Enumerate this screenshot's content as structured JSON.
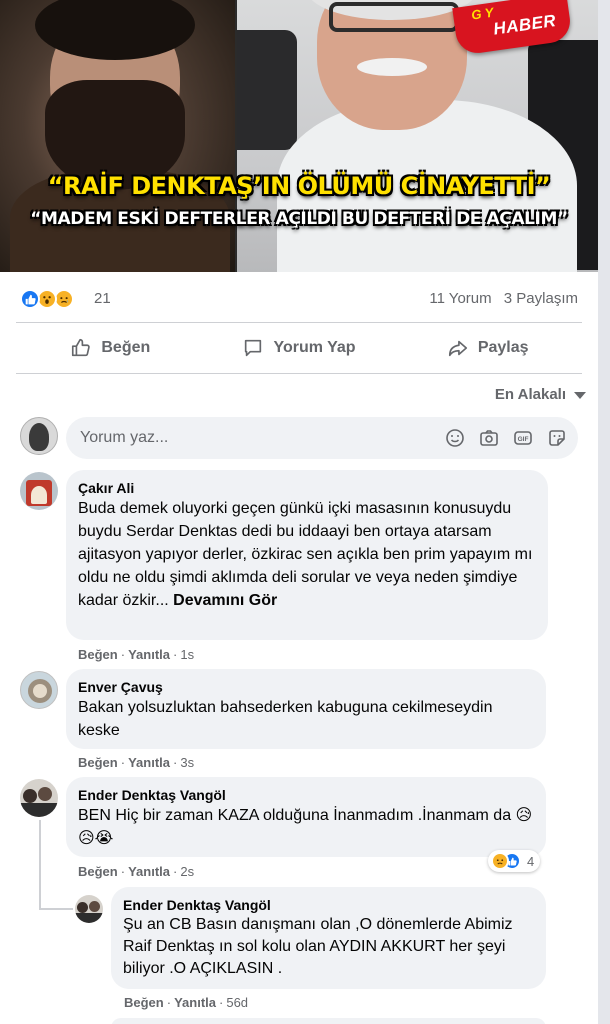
{
  "post": {
    "headline": "“RAİF DENKTAŞ’IN ÖLÜMÜ CİNAYETTİ”",
    "subheadline": "“MADEM ESKİ DEFTERLER AÇILDI BU DEFTERİ DE AÇALIM”",
    "badge_top": "G Y",
    "badge_bottom": "HABER"
  },
  "stats": {
    "reactions": [
      "like-icon",
      "wow-icon",
      "sad-icon"
    ],
    "reaction_count": "21",
    "comments": "11 Yorum",
    "shares": "3 Paylaşım"
  },
  "actions": {
    "like": "Beğen",
    "comment": "Yorum Yap",
    "share": "Paylaş"
  },
  "sort": {
    "label": "En Alakalı"
  },
  "composer": {
    "placeholder": "Yorum yaz..."
  },
  "comments": [
    {
      "name": "Çakır Ali",
      "text": "Buda demek oluyorki geçen günkü içki masasının konusuydu buydu Serdar Denktas dedi bu iddaayi ben ortaya atarsam ajitasyon yapıyor derler, özkirac sen açıkla ben prim yapayım mı oldu ne oldu şimdi aklımda deli sorular ve veya neden şimdiye kadar özkir...",
      "see_more": "Devamını Gör",
      "like": "Beğen",
      "reply": "Yanıtla",
      "time": "1s"
    },
    {
      "name": "Enver Çavuş",
      "text": "Bakan yolsuzluktan bahsederken kabuguna cekilmeseydin keske",
      "like": "Beğen",
      "reply": "Yanıtla",
      "time": "3s"
    },
    {
      "name": "Ender Denktaş Vangöl",
      "text": "BEN Hiç bir zaman KAZA olduğuna İnanmadım .İnanmam da 😥😥😭",
      "like": "Beğen",
      "reply": "Yanıtla",
      "time": "2s",
      "reaction_count": "4"
    },
    {
      "name": "Ender Denktaş Vangöl",
      "text": "Şu an CB Basın danışmanı olan ,O dönemlerde Abimiz Raif Denktaş ın sol kolu olan AYDIN AKKURT her şeyi biliyor .O AÇIKLASIN .",
      "like": "Beğen",
      "reply": "Yanıtla",
      "time": "56d"
    }
  ],
  "colors": {
    "brand_blue": "#1877f2",
    "text_secondary": "#65676b",
    "bubble_bg": "#f0f2f5",
    "headline_yellow": "#ffe100",
    "badge_red": "#d8141f"
  }
}
